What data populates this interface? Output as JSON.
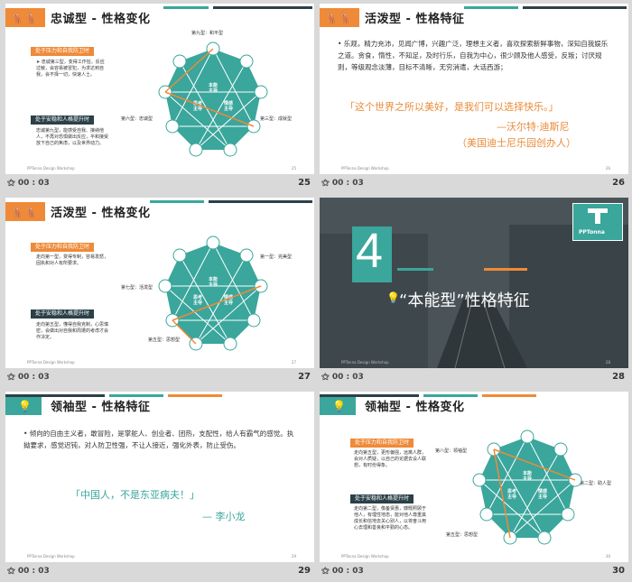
{
  "colors": {
    "teal": "#3aa69c",
    "orange": "#ef8a38",
    "dark": "#2b4048",
    "bg": "#d9d9d9"
  },
  "icons": [
    "slide-icon",
    "reindeer-logo-icon",
    "lightbulb-icon",
    "enneagram-wheel"
  ],
  "footer": "PPTonna Design Workshop",
  "slides": [
    {
      "number": "25",
      "time": "00 : 03",
      "title": "忠诚型 - 性格变化",
      "label1": "处于压力和自我防卫时",
      "note1": "➤ 忠诚第三型，变得工作狂，反应过敏，会容易被冒犯，为求达到自我，会不择一切，快速人士。",
      "label2": "处于安稳和人格提升时",
      "note2": "忠诚第九型，能感受自我、接纳他人，不再对恐惧做出反应，平和接受放下自己的焦虑，以及世界动力。",
      "top": "第九型：和平型",
      "left": "第六型：忠诚型",
      "right": "第三型：成就型",
      "page": "25"
    },
    {
      "number": "26",
      "time": "00 : 03",
      "title": "活泼型 - 性格特征",
      "body": "• 乐观，精力充沛，见闻广博，兴趣广泛，理想主义者，喜欢探索新鲜事物，深知自我娱乐之道。贪食，惰性，不知足，及时行乐，自我为中心，很少顾及他人感受，反叛；讨厌规则，等级观念淡薄，目标不清晰，无穷消遣，大话西游；",
      "quote": "「这个世界之所以美好，是我们可以选择快乐。」",
      "author": "—沃尔特·迪斯尼",
      "author2": "（美国迪士尼乐园创办人）",
      "page": "26"
    },
    {
      "number": "27",
      "time": "00 : 03",
      "title": "活泼型 - 性格变化",
      "label1": "处于压力和自我防卫时",
      "note1": "走向第一型，变得专制，容易发怒，固执和对人有所要求。",
      "label2": "处于安稳和人格提升时",
      "note2": "走向第五型，懂得自我克制，心思慎密，会做出对自我和周遭的考虑才会作决定。",
      "top": "第一型：完美型",
      "left": "第七型：活泼型",
      "right": "第五型：思想型",
      "page": "27"
    },
    {
      "number": "28",
      "time": "00 : 03",
      "big": "4",
      "title": "“本能型”性格特征",
      "brand": "PPTonna",
      "page": "28"
    },
    {
      "number": "29",
      "time": "00 : 03",
      "title": "领袖型 - 性格特征",
      "body": "• 倾向的自由主义者，敢冒险，是掌舵人、创业者、团热，支配性，给人有霸气的感觉。执拗要求，感觉迟钝，对人防卫性强，不让人接近，强化外表，防止受伤。",
      "quote": "「中国人，不是东亚病夫！」",
      "author": "— 李小龙",
      "page": "29"
    },
    {
      "number": "30",
      "time": "00 : 03",
      "title": "领袖型 - 性格变化",
      "label1": "处于压力和自我防卫时",
      "note1": "走向第五型，更形偏强，远离人群，会对人质疑，以自己的论据去设人联想，有时份得象。",
      "label2": "处于安稳和人格提升时",
      "note2": "走向第二型，像备贤惠，慷慨照顾于他人，有理性地态，能对他人尊重其成长和信地去关心别人，以将奋斗用心去理和善良和平勤的心态。",
      "top": "第八型：领袖型",
      "left": "第五型：思想型",
      "right": "第二型：助人型",
      "page": "30"
    }
  ],
  "wheel": {
    "c1": "本能",
    "c2": "主导",
    "c3": "思考",
    "c4": "主导",
    "c5": "情感",
    "c6": "主导"
  }
}
